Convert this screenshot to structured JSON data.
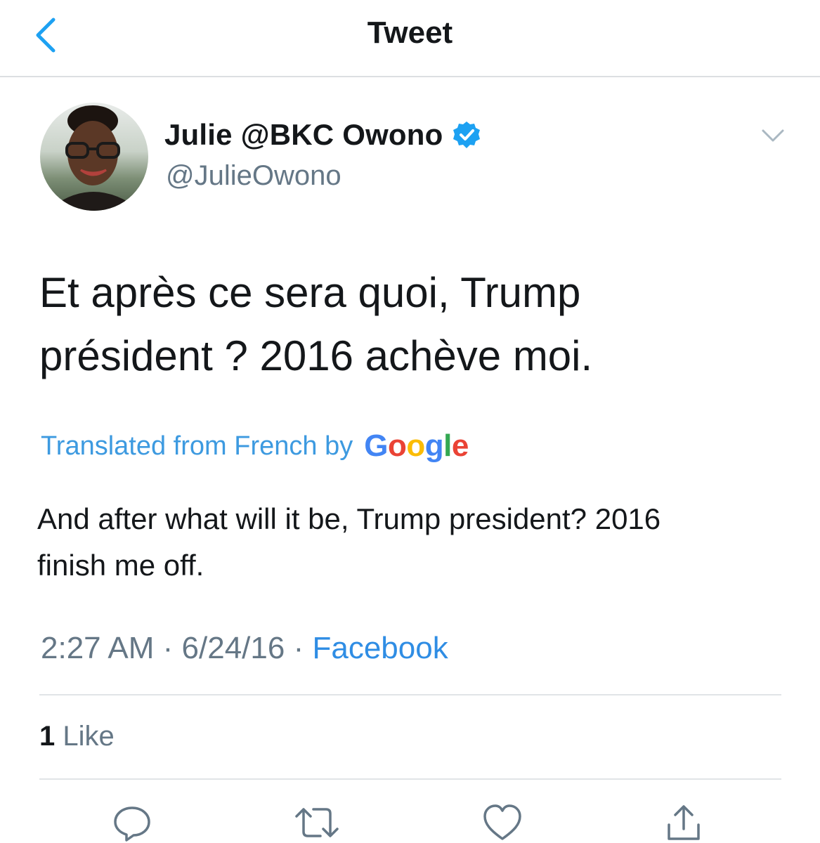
{
  "header": {
    "title": "Tweet",
    "back_icon": "chevron-left-icon"
  },
  "tweet": {
    "display_name": "Julie @BKC Owono",
    "handle": "@JulieOwono",
    "verified_icon": "verified-badge-icon",
    "menu_icon": "chevron-down-icon",
    "text_line1": "Et après ce sera quoi, Trump",
    "text_line2": "président ? 2016 achève moi.",
    "translated_label": "Translated from French by",
    "translator_brand": "Google",
    "translation_line1": "And after what will it be, Trump president? 2016",
    "translation_line2": "finish me off.",
    "time": "2:27 AM",
    "date": "6/24/16",
    "separator": " · ",
    "source": "Facebook",
    "likes_count": "1",
    "likes_label": "Like"
  },
  "actions": [
    {
      "name": "reply",
      "icon": "reply-icon"
    },
    {
      "name": "retweet",
      "icon": "retweet-icon"
    },
    {
      "name": "like",
      "icon": "heart-icon"
    },
    {
      "name": "share",
      "icon": "share-icon"
    }
  ],
  "colors": {
    "accent": "#1da1f2",
    "link": "#2f8de4",
    "secondary_text": "#657786",
    "google_blue": "#4285f4",
    "google_red": "#ea4335",
    "google_yellow": "#fbbc05",
    "google_green": "#34a853"
  }
}
